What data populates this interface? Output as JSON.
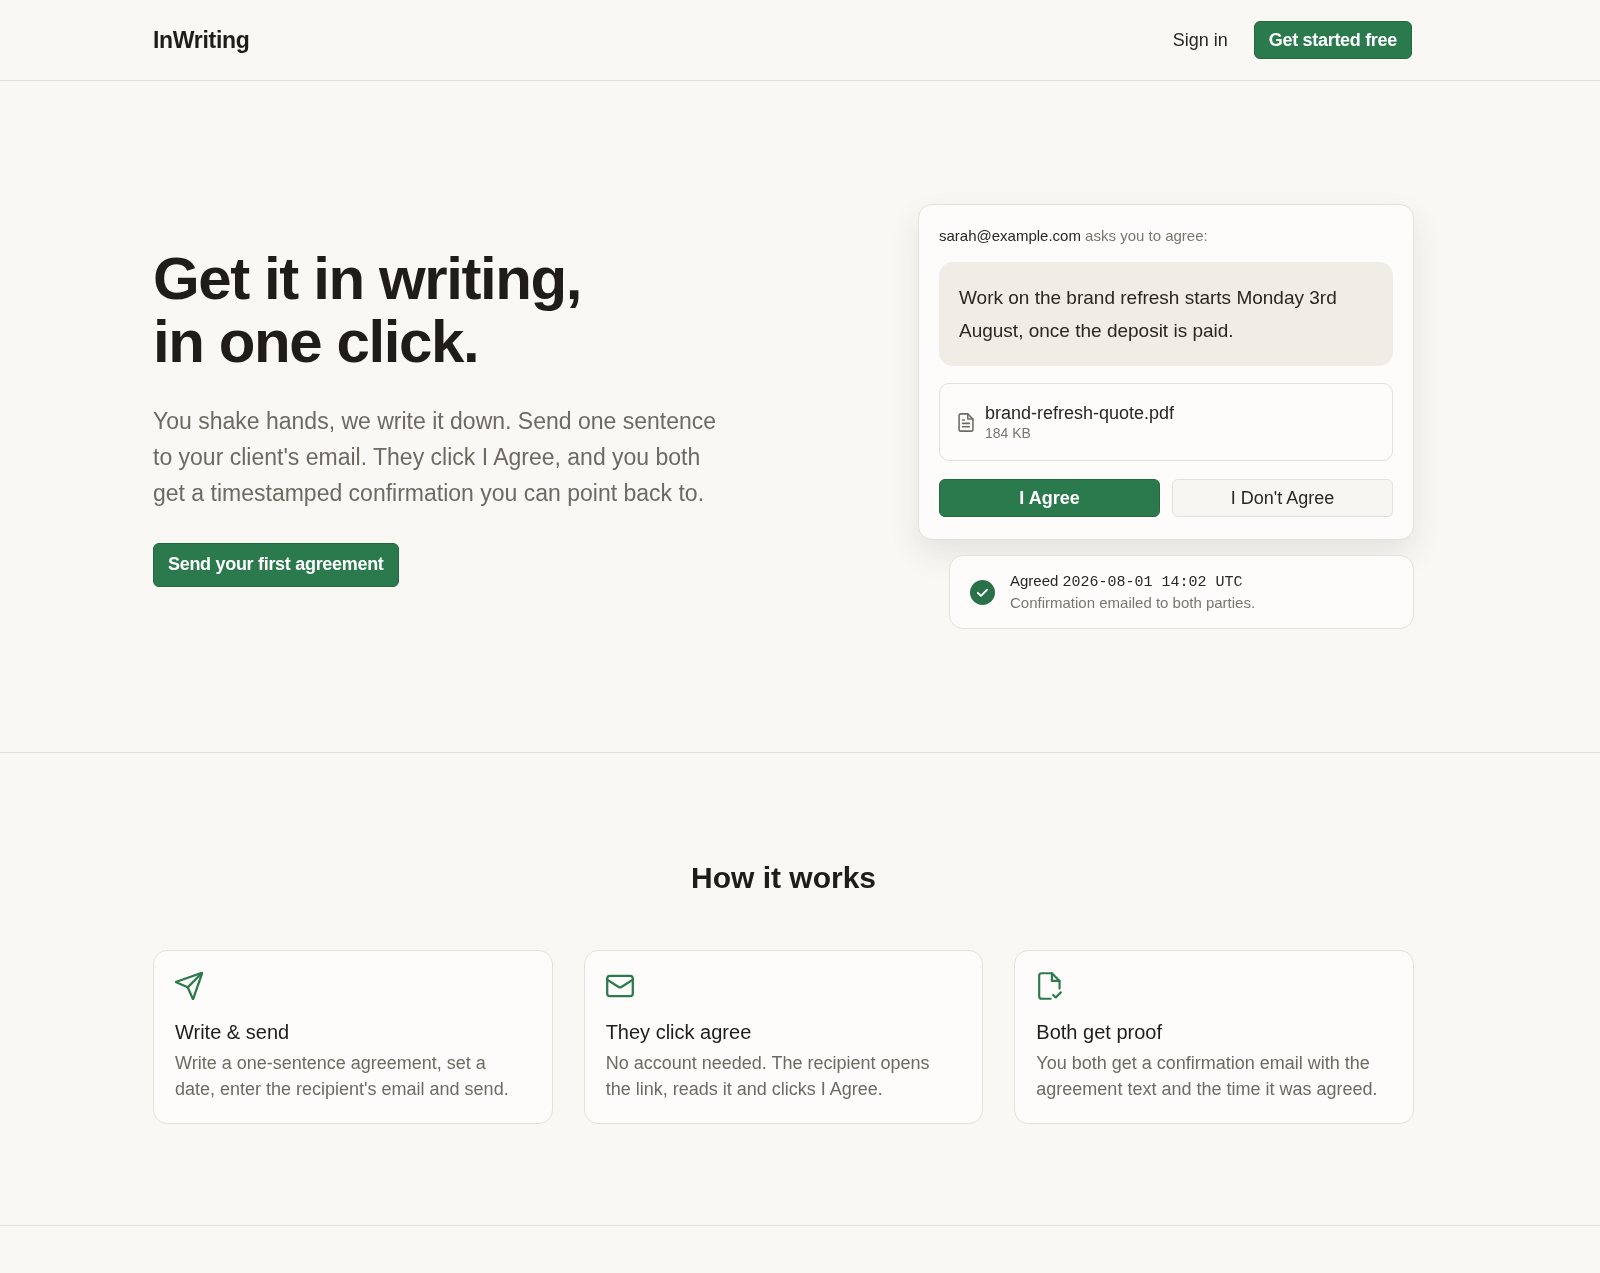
{
  "header": {
    "logo": "InWriting",
    "sign_in": "Sign in",
    "cta": "Get started free"
  },
  "hero": {
    "heading_lines": [
      "Get it in writing,",
      "in one click."
    ],
    "intro": "You shake hands, we write it down. Send one sentence to your client's email. They click I Agree, and you both get a timestamped confirmation you can point back to.",
    "cta": "Send your first agreement"
  },
  "agreement_card": {
    "sender": "sarah@example.com",
    "prompt": "asks you to agree:",
    "statement": "Work on the brand refresh starts Monday 3rd August, once the deposit is paid.",
    "attachment": {
      "name": "brand-refresh-quote.pdf",
      "size": "184 KB"
    },
    "buttons": [
      {
        "label": "I Agree",
        "kind": "primary"
      },
      {
        "label": "I Don't Agree",
        "kind": "secondary"
      }
    ]
  },
  "confirmation": {
    "status": "Agreed",
    "timestamp": "2026-08-01 14:02 UTC",
    "note": "Confirmation emailed to both parties."
  },
  "how_it_works": {
    "title": "How it works",
    "steps": [
      {
        "title": "Write & send",
        "text": "Write a one-sentence agreement, set a date, enter the recipient's email and send."
      },
      {
        "title": "They click agree",
        "text": "No account needed. The recipient opens the link, reads it and clicks I Agree."
      },
      {
        "title": "Both get proof",
        "text": "You both get a confirmation email with the agreement text and the time it was agreed."
      }
    ]
  }
}
